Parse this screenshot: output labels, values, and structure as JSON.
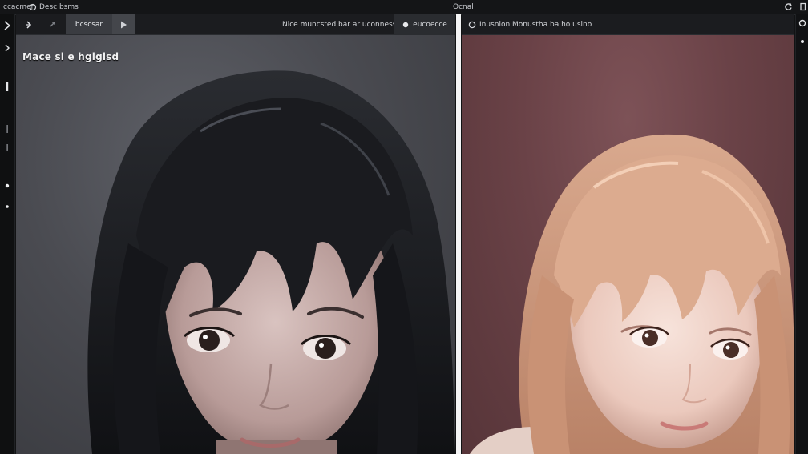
{
  "topbar": {
    "left_text_1": "ccacmer",
    "left_text_2": "Desc bsms",
    "center_text": "Ocnal",
    "right_icon_1": "refresh-icon",
    "right_icon_2": "gear-icon"
  },
  "left_panel": {
    "toolbar": {
      "tab_label": "bcscsar",
      "status_text": "Nice muncsted bar ar uconness",
      "preset_label": "eucoecce"
    },
    "overlay_label": "Mace si e hgigisd"
  },
  "right_panel": {
    "toolbar": {
      "status_text": "Inusnion Monustha ba ho usino"
    }
  },
  "colors": {
    "accent": "#e7e9ec",
    "panel_header": "#1b1c1f",
    "left_bg": "#4a4b51",
    "right_bg": "#6a4247"
  }
}
